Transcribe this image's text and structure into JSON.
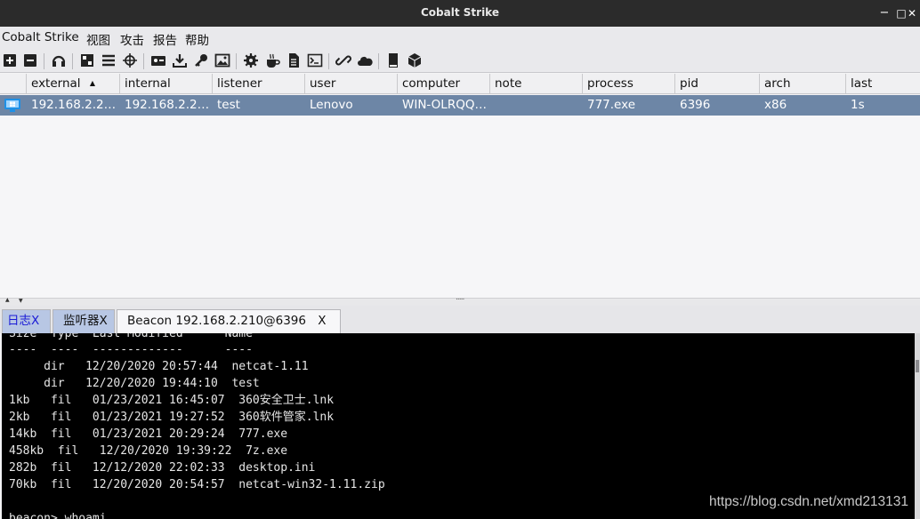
{
  "window": {
    "title": "Cobalt Strike",
    "minimize": "−",
    "maximize": "□",
    "close": "✕"
  },
  "menu": [
    {
      "id": "cs",
      "label": "Cobalt Strike"
    },
    {
      "id": "view",
      "label": "视图"
    },
    {
      "id": "attack",
      "label": "攻击"
    },
    {
      "id": "report",
      "label": "报告"
    },
    {
      "id": "help",
      "label": "帮助"
    }
  ],
  "toolbar_icons": [
    "new-connection-icon",
    "disconnect-icon",
    "listeners-icon",
    "pivot-graph-icon",
    "session-table-icon",
    "target-table-icon",
    "credentials-icon",
    "downloaded-files-icon",
    "keystrokes-icon",
    "screenshots-icon",
    "payload-generator-icon",
    "java-applet-icon",
    "ms-office-macro-icon",
    "web-delivery-icon",
    "manage-web-server-icon",
    "host-file-icon",
    "help-docs-icon",
    "about-icon"
  ],
  "table": {
    "columns": [
      "external",
      "internal",
      "listener",
      "user",
      "computer",
      "note",
      "process",
      "pid",
      "arch",
      "last"
    ],
    "sorted_column": "external",
    "sort_indicator": "▲",
    "rows": [
      {
        "external": "192.168.2.2…",
        "internal": "192.168.2.2…",
        "listener": "test",
        "user": "Lenovo",
        "computer": "WIN-OLRQQ…",
        "note": "",
        "process": "777.exe",
        "pid": "6396",
        "arch": "x86",
        "last": "1s"
      }
    ],
    "selected_color": "#6d86a6"
  },
  "splitter": {
    "collapse_up": "▲",
    "collapse_down": "▼",
    "grip": "....."
  },
  "tabs": [
    {
      "label": "日志",
      "close": "X",
      "active": false
    },
    {
      "label": "监听器",
      "close": "X",
      "active": false
    },
    {
      "label": "Beacon 192.168.2.210@6396",
      "close": "X",
      "active": true
    }
  ],
  "console": {
    "lines": [
      "Size  Type  Last Modified      Name",
      "----  ----  -------------      ----",
      "     dir   12/20/2020 20:57:44  netcat-1.11",
      "     dir   12/20/2020 19:44:10  test",
      "1kb   fil   01/23/2021 16:45:07  360安全卫士.lnk",
      "2kb   fil   01/23/2021 19:27:52  360软件管家.lnk",
      "14kb  fil   01/23/2021 20:29:24  777.exe",
      "458kb  fil   12/20/2020 19:39:22  7z.exe",
      "282b  fil   12/12/2020 22:02:33  desktop.ini",
      "70kb  fil   12/20/2020 20:54:57  netcat-win32-1.11.zip",
      "",
      "beacon> whoami"
    ]
  },
  "watermark": "https://blog.csdn.net/xmd213131"
}
